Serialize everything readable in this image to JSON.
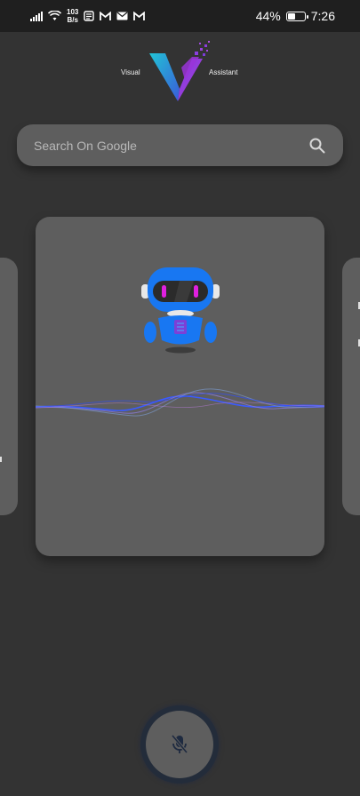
{
  "status_bar": {
    "net_speed_value": "103",
    "net_speed_unit": "B/s",
    "battery_percent_label": "44%",
    "battery_level": 0.44,
    "time": "7:26",
    "icons": [
      "signal-icon",
      "wifi-icon",
      "news-icon",
      "gmail-icon",
      "mail-icon",
      "gmail-icon"
    ]
  },
  "logo": {
    "left_text": "Visual",
    "right_text": "Assistant"
  },
  "search": {
    "placeholder": "Search On Google"
  },
  "mic": {
    "state": "muted",
    "icon": "mic-off-icon"
  },
  "colors": {
    "background": "#333333",
    "card": "#5e5e5e",
    "robot_blue": "#1877f2",
    "robot_eye": "#e020e0",
    "wave_blue": "#3b5bff"
  }
}
